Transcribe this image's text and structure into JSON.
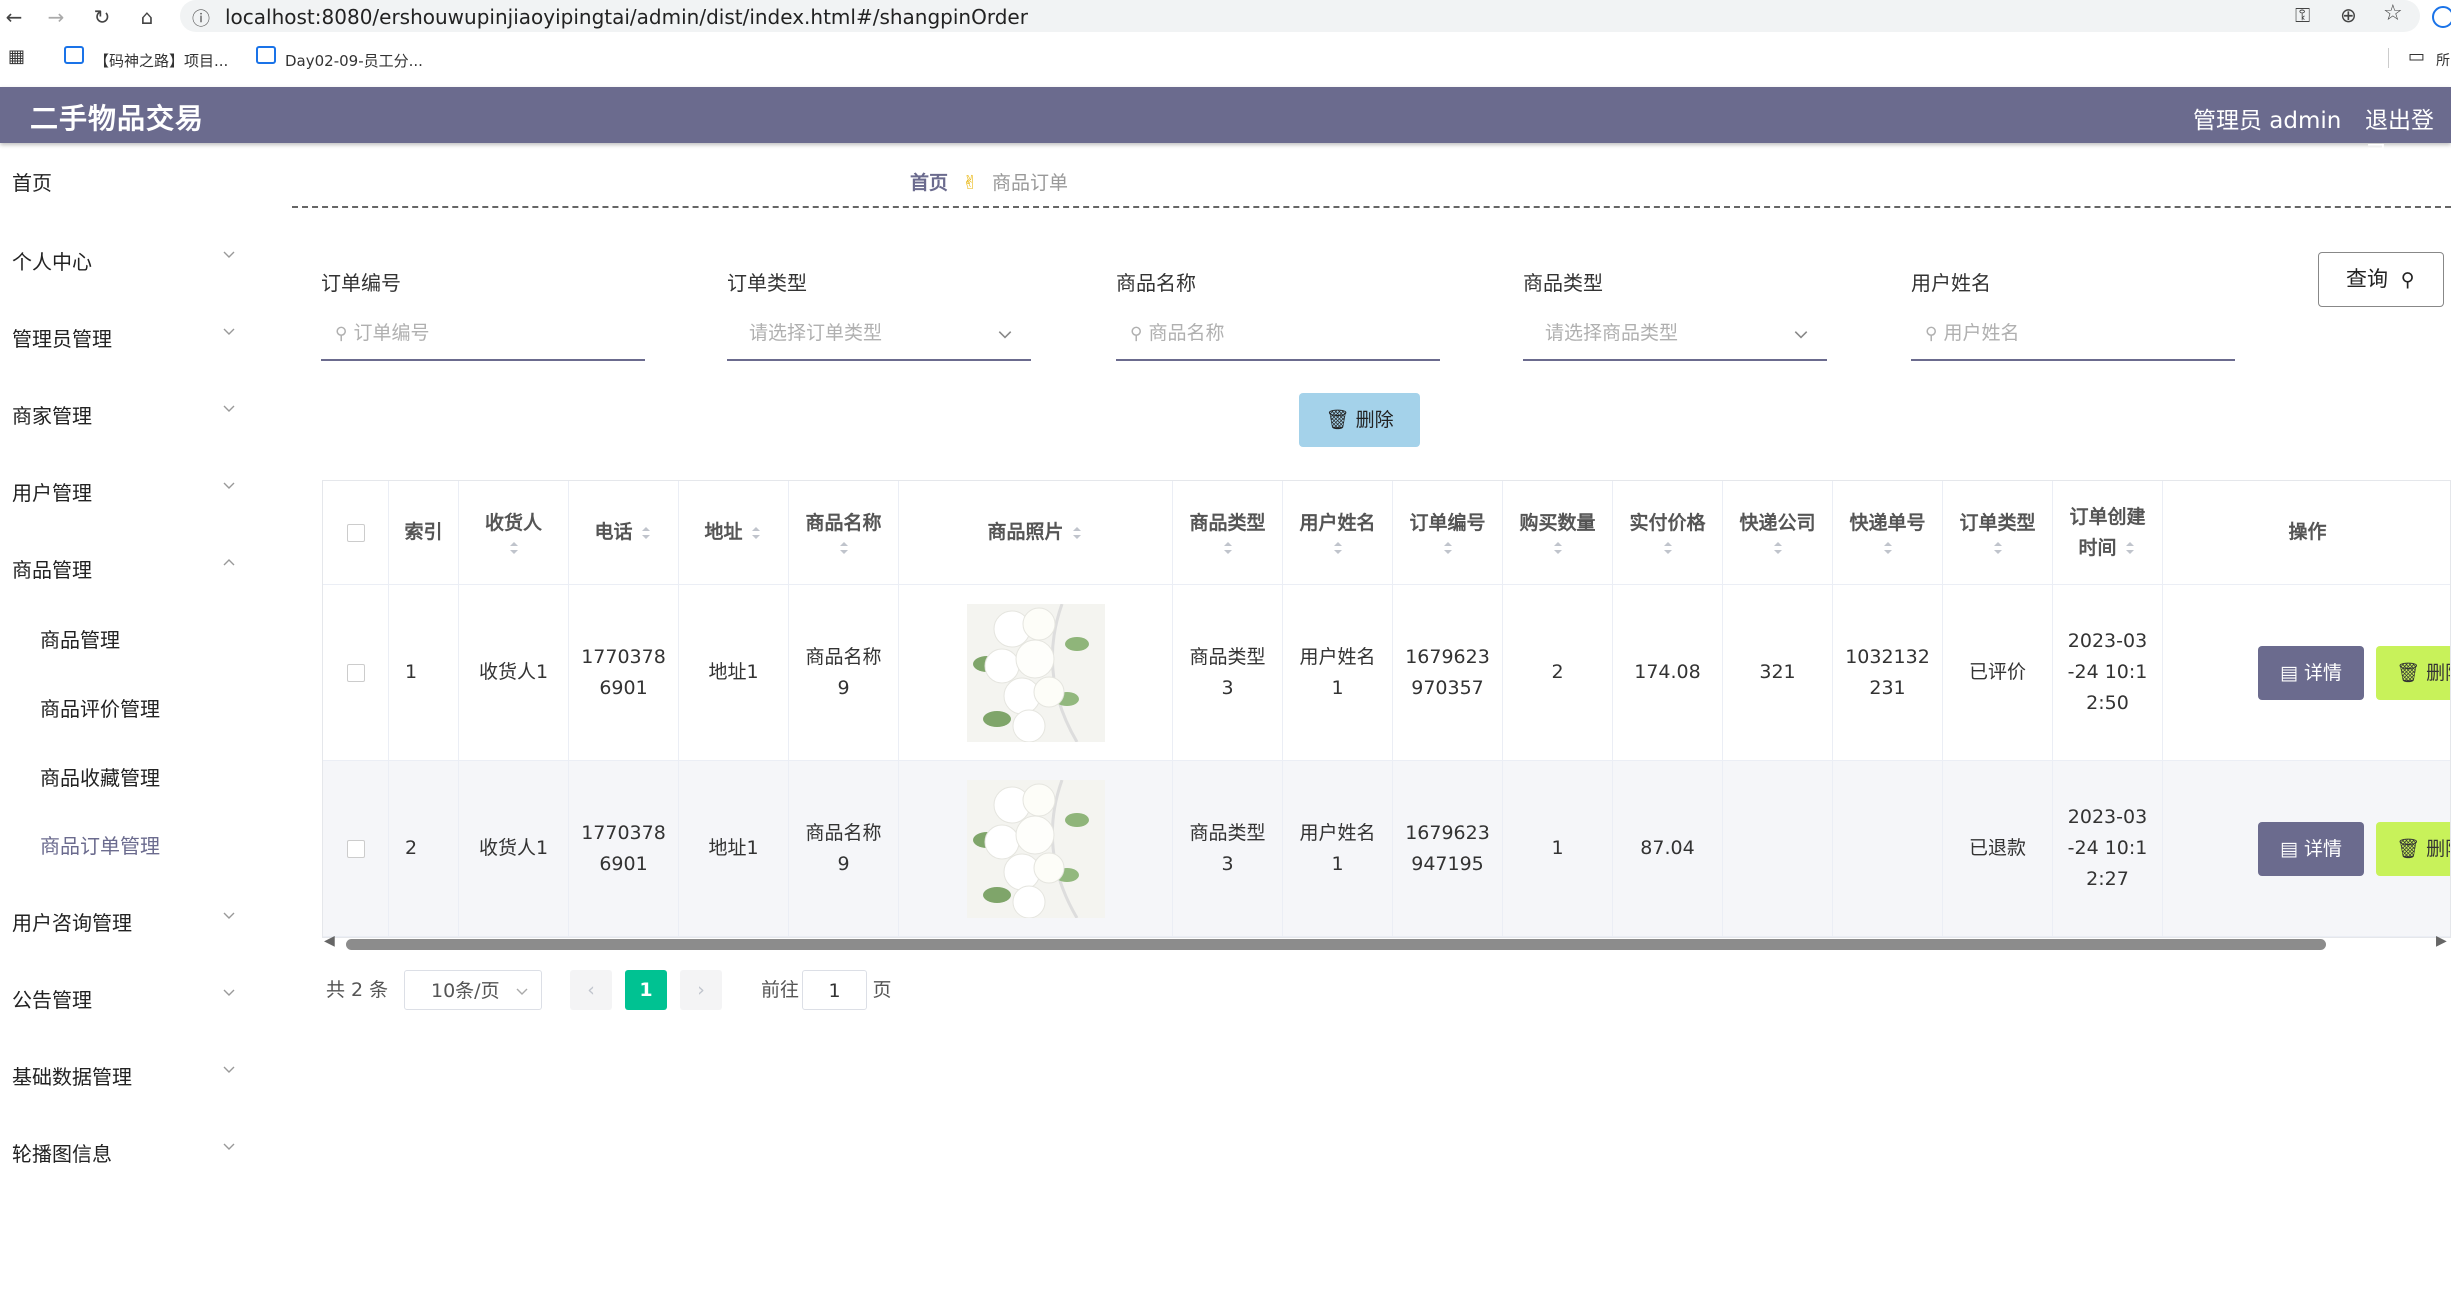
{
  "browser": {
    "url": "localhost:8080/ershouwupinjiaoyipingtai/admin/dist/index.html#/shangpinOrder",
    "bookmarks": [
      "【码神之路】项目...",
      "Day02-09-员工分..."
    ],
    "bookmark_right": "所"
  },
  "header": {
    "title": "二手物品交易",
    "admin": "管理员 admin",
    "logout": "退出登录"
  },
  "sidebar": {
    "home": "首页",
    "items": [
      "个人中心",
      "管理员管理",
      "商家管理",
      "用户管理",
      "商品管理"
    ],
    "sub": [
      "商品管理",
      "商品评价管理",
      "商品收藏管理",
      "商品订单管理"
    ],
    "items2": [
      "用户咨询管理",
      "公告管理",
      "基础数据管理",
      "轮播图信息"
    ]
  },
  "breadcrumb": {
    "home": "首页",
    "current": "商品订单"
  },
  "filters": {
    "labels": [
      "订单编号",
      "订单类型",
      "商品名称",
      "商品类型",
      "用户姓名"
    ],
    "placeholders": [
      "订单编号",
      "请选择订单类型",
      "商品名称",
      "请选择商品类型",
      "用户姓名"
    ],
    "query": "查询",
    "delete": "删除"
  },
  "table": {
    "headers": [
      "索引",
      "收货人",
      "电话",
      "地址",
      "商品名称",
      "商品照片",
      "商品类型",
      "用户姓名",
      "订单编号",
      "购买数量",
      "实付价格",
      "快递公司",
      "快递单号",
      "订单类型",
      "订单创建时间",
      "操作"
    ],
    "header_wrapped": {
      "created_1": "订单创建",
      "created_2": "时间"
    },
    "rows": [
      {
        "index": "1",
        "receiver": "收货人1",
        "phone1": "1770378",
        "phone2": "6901",
        "address": "地址1",
        "name1": "商品名称",
        "name2": "9",
        "type1": "商品类型",
        "type2": "3",
        "user1": "用户姓名",
        "user2": "1",
        "order1": "1679623",
        "order2": "970357",
        "qty": "2",
        "price": "174.08",
        "courier": "321",
        "track1": "1032132",
        "track2": "231",
        "otype": "已评价",
        "t1": "2023-03",
        "t2": "-24 10:1",
        "t3": "2:50"
      },
      {
        "index": "2",
        "receiver": "收货人1",
        "phone1": "1770378",
        "phone2": "6901",
        "address": "地址1",
        "name1": "商品名称",
        "name2": "9",
        "type1": "商品类型",
        "type2": "3",
        "user1": "用户姓名",
        "user2": "1",
        "order1": "1679623",
        "order2": "947195",
        "qty": "1",
        "price": "87.04",
        "courier": "",
        "track1": "",
        "track2": "",
        "otype": "已退款",
        "t1": "2023-03",
        "t2": "-24 10:1",
        "t3": "2:27"
      }
    ],
    "detail_label": "详情",
    "delete_label": "删除"
  },
  "pagination": {
    "total": "共 2 条",
    "pagesize": "10条/页",
    "current": "1",
    "goto": "前往",
    "goto_value": "1",
    "page_suffix": "页"
  },
  "colors": {
    "header": "#6b6b8e",
    "accent": "#00c292",
    "delete_btn": "#a4d2ea",
    "row_delete": "#c8f25a"
  }
}
